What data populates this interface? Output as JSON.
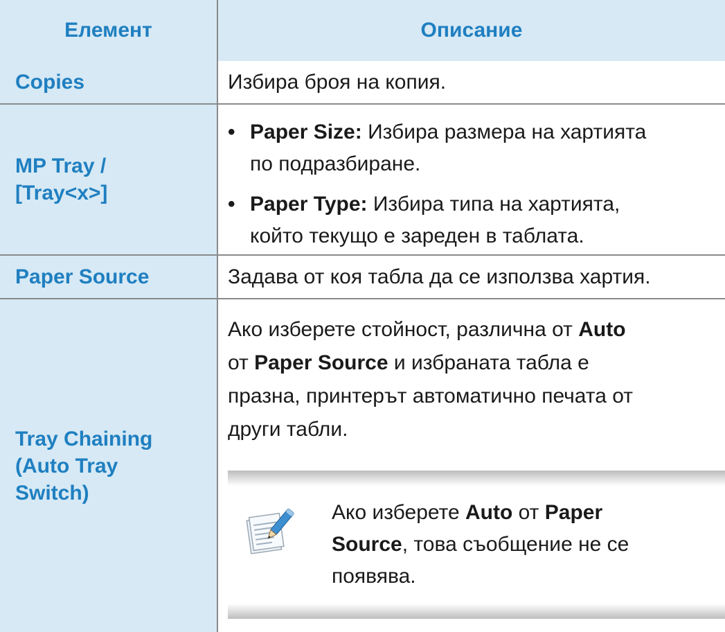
{
  "header": {
    "col1": "Елемент",
    "col2": "Описание"
  },
  "rows": {
    "copies": {
      "label": "Copies",
      "desc": "Избира броя на копия."
    },
    "mptray": {
      "label_l1": "MP Tray /",
      "label_l2": "[Tray<x>]",
      "b1_bold": "Paper Size:",
      "b1_l1": " Избира размера на хартията",
      "b1_l2": "по подразбиране.",
      "b2_bold": "Paper Type:",
      "b2_l1": " Избира типа на хартията,",
      "b2_l2": "който текущо е зареден в таблата."
    },
    "papersource": {
      "label": "Paper Source",
      "desc": "Задава от коя табла да се използва хартия."
    },
    "traychaining": {
      "label_l1": "Tray Chaining",
      "label_l2": "(Auto Tray",
      "label_l3": "Switch)",
      "p_l1a": "Ако изберете стойност, различна от ",
      "p_l1b": "Auto",
      "p_l2a": "от ",
      "p_l2b": "Paper Source",
      "p_l2c": " и избраната табла е",
      "p_l3": "празна, принтерът автоматично печата от",
      "p_l4": "други табли.",
      "note_l1a": "Ако изберете ",
      "note_l1b": "Auto",
      "note_l1c": " от ",
      "note_l1d": "Paper",
      "note_l2a": "Source",
      "note_l2b": ", това съобщение не се",
      "note_l3": "появява.",
      "note_icon": "note-pencil-icon"
    }
  }
}
